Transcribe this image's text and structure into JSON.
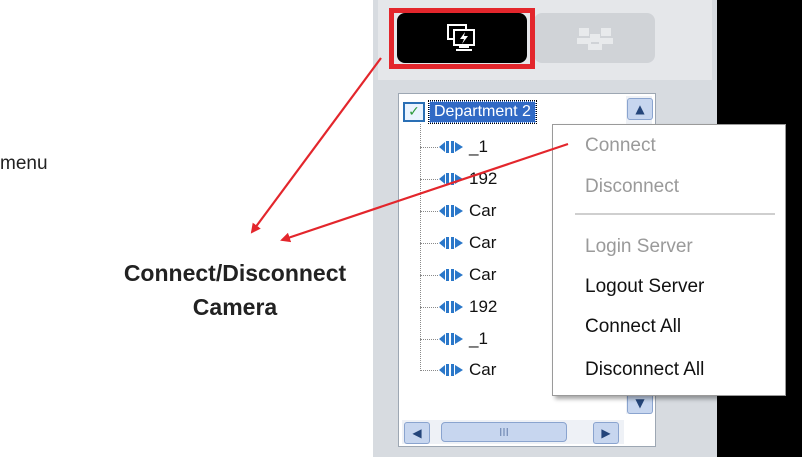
{
  "annotations": {
    "menu_text": "menu",
    "caption_line1": "Connect/Disconnect",
    "caption_line2": "Camera",
    "arrow_color": "#e3262c"
  },
  "tabs": {
    "active_icon": "monitor-lightning-icon",
    "inactive_icon": "group-users-icon",
    "highlight_color": "#e3262c"
  },
  "tree": {
    "root_label": "Department 2",
    "items": [
      {
        "label": "_1"
      },
      {
        "label": "192"
      },
      {
        "label": "Car"
      },
      {
        "label": "Car"
      },
      {
        "label": "Car"
      },
      {
        "label": "192"
      },
      {
        "label": "_1"
      },
      {
        "label": "Car"
      }
    ]
  },
  "context_menu": {
    "items": [
      {
        "label": "Connect",
        "enabled": false
      },
      {
        "label": "Disconnect",
        "enabled": false
      },
      {
        "label": "Login Server",
        "enabled": false
      },
      {
        "label": "Logout Server",
        "enabled": true
      },
      {
        "label": "Connect All",
        "enabled": true
      },
      {
        "label": "Disconnect All",
        "enabled": true
      }
    ]
  },
  "scrollbar": {
    "thumb_grip": "III"
  }
}
